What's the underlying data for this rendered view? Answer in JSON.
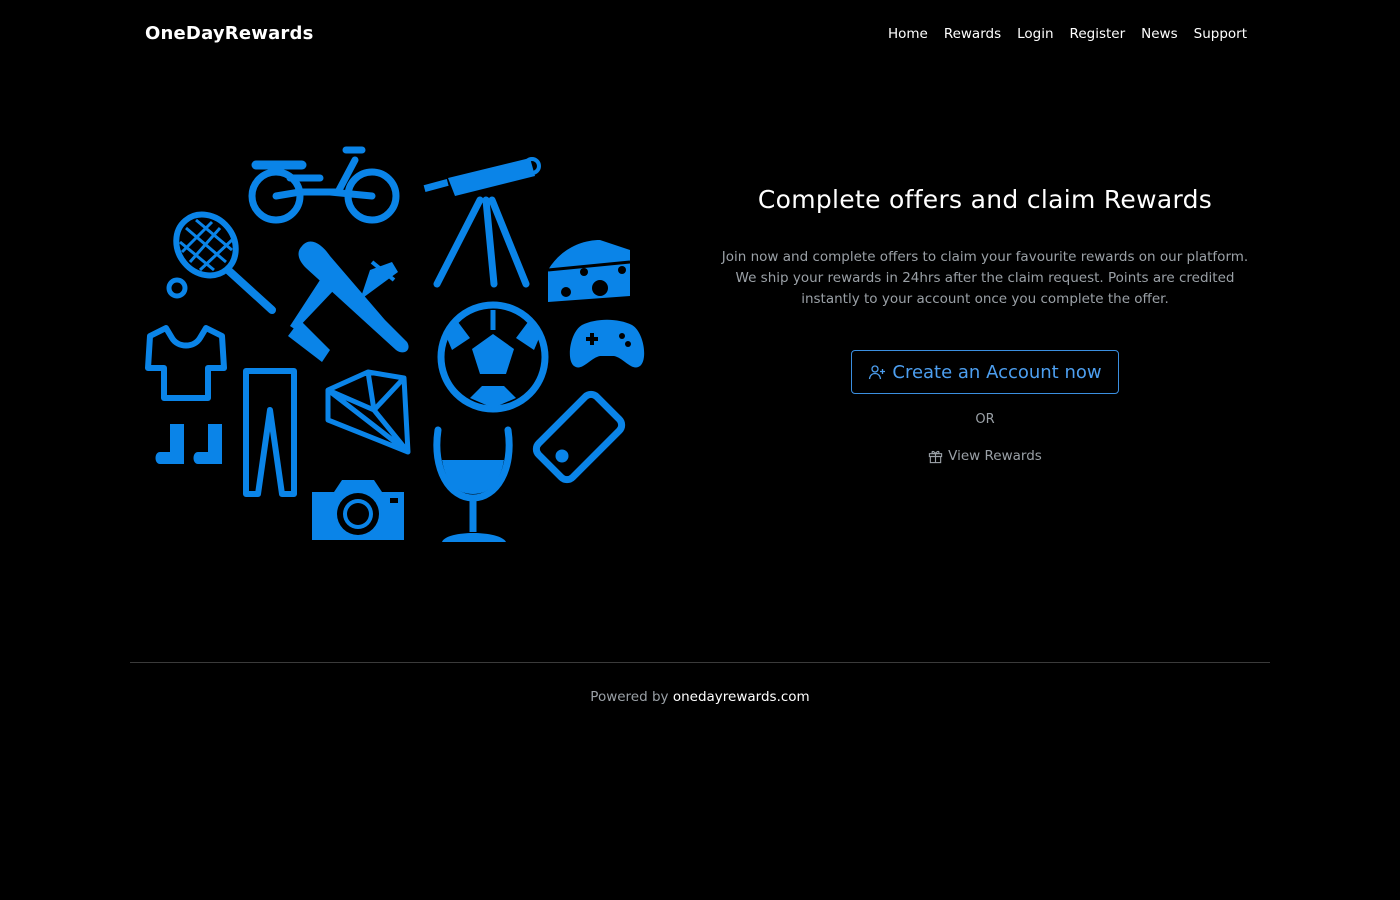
{
  "navbar": {
    "brand": "OneDayRewards",
    "links": [
      "Home",
      "Rewards",
      "Login",
      "Register",
      "News",
      "Support"
    ]
  },
  "hero": {
    "title": "Complete offers and claim Rewards",
    "description": "Join now and complete offers to claim your favourite rewards on our platform. We ship your rewards in 24hrs after the claim request. Points are credited instantly to your account once you complete the offer.",
    "cta_label": "Create an Account now",
    "or_label": "OR",
    "view_rewards_label": "View Rewards"
  },
  "footer": {
    "powered_by": "Powered by",
    "link_text": "onedayrewards.com"
  },
  "colors": {
    "accent": "#0a84e8",
    "button_border": "#3b8fe0",
    "muted_text": "#9aa0a6",
    "background": "#000000"
  },
  "icons": [
    "user-plus-icon",
    "gift-icon",
    "motorcycle-icon",
    "telescope-icon",
    "tennis-racket-icon",
    "airplane-icon",
    "cheese-icon",
    "tshirt-icon",
    "soccer-ball-icon",
    "gamepad-icon",
    "socks-icon",
    "pants-icon",
    "diamond-icon",
    "smartphone-icon",
    "camera-icon",
    "wine-glass-icon"
  ]
}
